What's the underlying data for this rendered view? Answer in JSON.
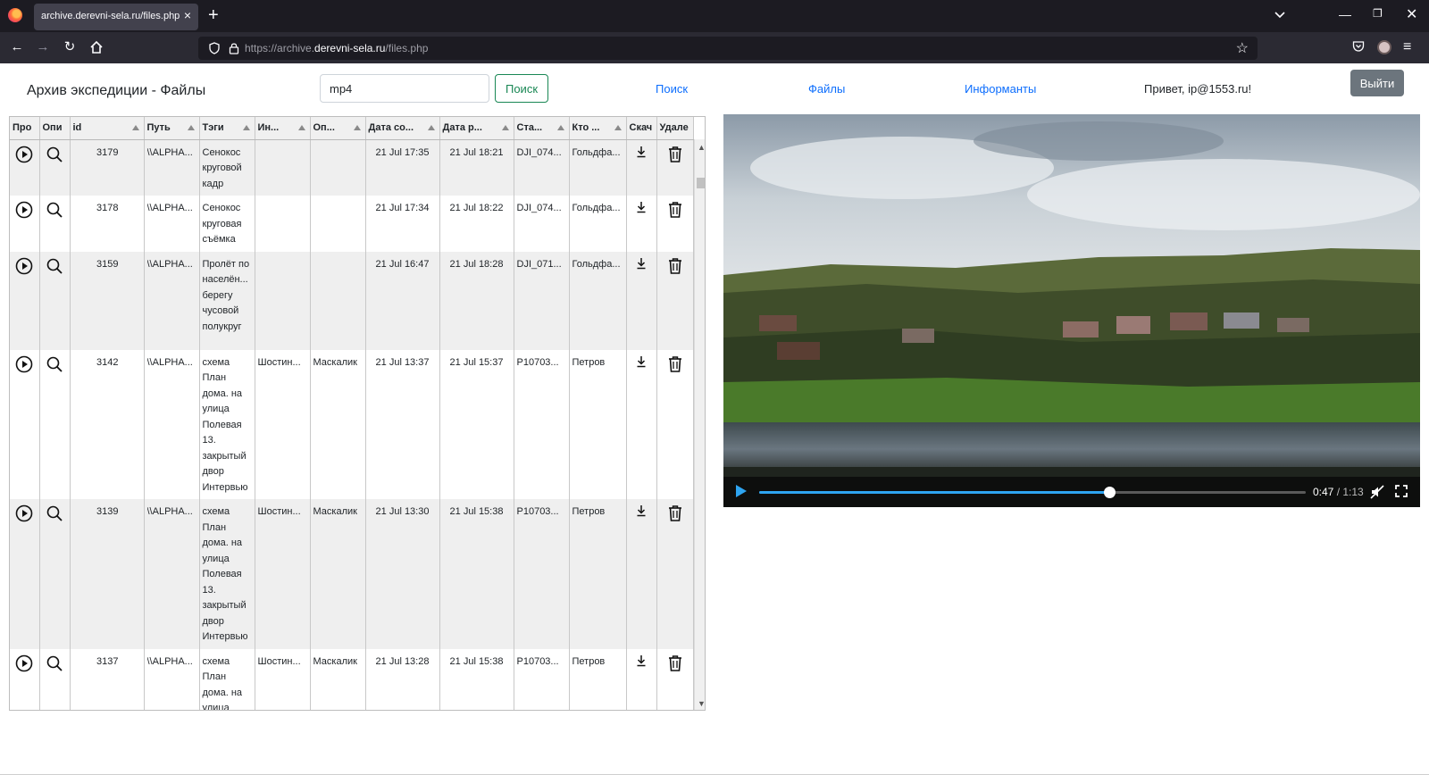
{
  "browser": {
    "tab_title": "archive.derevni-sela.ru/files.php",
    "tab_close": "×",
    "new_tab": "+",
    "url_prefix": "https://archive.",
    "url_host": "derevni-sela.ru",
    "url_path": "/files.php"
  },
  "header": {
    "brand": "Архив экспедиции - Файлы",
    "search_value": "mp4",
    "search_button": "Поиск",
    "nav": [
      "Поиск",
      "Файлы",
      "Информанты"
    ],
    "greeting": "Привет, ip@1553.ru!",
    "logout": "Выйти"
  },
  "table": {
    "columns": [
      "Про",
      "Опи",
      "id",
      "Путь",
      "Тэги",
      "Ин...",
      "Оп...",
      "Дата со...",
      "Дата р...",
      "Ста...",
      "Кто ...",
      "Скач",
      "Удале"
    ],
    "rows": [
      {
        "id": "3179",
        "path": "\\\\ALPHA...",
        "tags": "Сенокос круговой кадр",
        "informant": "",
        "operator": "",
        "date_created": "21 Jul 17:35",
        "date_loaded": "21 Jul 18:21",
        "original": "DJI_074...",
        "who": "Гольдфа..."
      },
      {
        "id": "3178",
        "path": "\\\\ALPHA...",
        "tags": "Сенокос круговая съёмка",
        "informant": "",
        "operator": "",
        "date_created": "21 Jul 17:34",
        "date_loaded": "21 Jul 18:22",
        "original": "DJI_074...",
        "who": "Гольдфа..."
      },
      {
        "id": "3159",
        "path": "\\\\ALPHA...",
        "tags": "Пролёт по населён... берегу чусовой полукруг",
        "informant": "",
        "operator": "",
        "date_created": "21 Jul 16:47",
        "date_loaded": "21 Jul 18:28",
        "original": "DJI_071...",
        "who": "Гольдфа..."
      },
      {
        "id": "3142",
        "path": "\\\\ALPHA...",
        "tags": "схема План дома. на улица Полевая 13. закрытый двор Интервью",
        "informant": "Шостин...",
        "operator": "Маскалик",
        "date_created": "21 Jul 13:37",
        "date_loaded": "21 Jul 15:37",
        "original": "P10703...",
        "who": "Петров"
      },
      {
        "id": "3139",
        "path": "\\\\ALPHA...",
        "tags": "схема План дома. на улица Полевая 13. закрытый двор Интервью",
        "informant": "Шостин...",
        "operator": "Маскалик",
        "date_created": "21 Jul 13:30",
        "date_loaded": "21 Jul 15:38",
        "original": "P10703...",
        "who": "Петров"
      },
      {
        "id": "3137",
        "path": "\\\\ALPHA...",
        "tags": "схема План дома. на улица Полевая",
        "informant": "Шостин...",
        "operator": "Маскалик",
        "date_created": "21 Jul 13:28",
        "date_loaded": "21 Jul 15:38",
        "original": "P10703...",
        "who": "Петров"
      }
    ]
  },
  "video": {
    "current_time": "0:47",
    "separator": " / ",
    "duration": "1:13",
    "progress": 0.64,
    "state": "paused",
    "muted": true
  },
  "icons": {
    "play_row": "play-circle-icon",
    "describe_row": "magnifier-icon",
    "download_row": "download-icon",
    "delete_row": "trash-icon"
  },
  "colors": {
    "link": "#0d6efd",
    "search_button": "#198754",
    "logout_button": "#6c757d",
    "video_progress": "#2ea4f0"
  }
}
